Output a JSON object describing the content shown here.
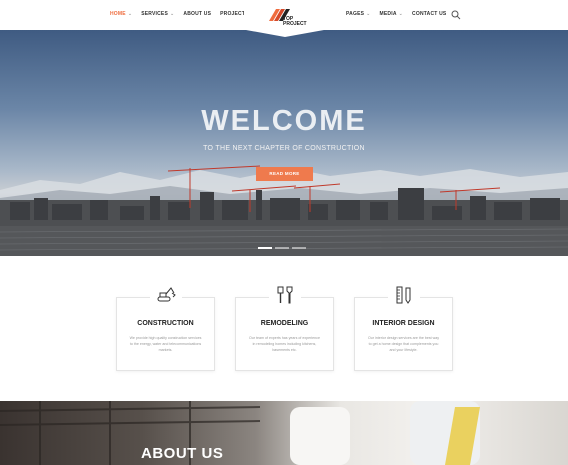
{
  "header": {
    "nav_left": [
      {
        "label": "HOME",
        "has_dropdown": true,
        "active": true
      },
      {
        "label": "SERVICES",
        "has_dropdown": true,
        "active": false
      },
      {
        "label": "ABOUT US",
        "has_dropdown": false,
        "active": false
      },
      {
        "label": "PROJECTS",
        "has_dropdown": true,
        "active": false
      }
    ],
    "nav_right": [
      {
        "label": "PAGES",
        "has_dropdown": true
      },
      {
        "label": "MEDIA",
        "has_dropdown": true
      },
      {
        "label": "CONTACT US",
        "has_dropdown": false
      }
    ],
    "logo_line1": "TOP",
    "logo_line2": "PROJECT",
    "search_icon": "search-icon",
    "chevron": "⌄"
  },
  "hero": {
    "title": "WELCOME",
    "subtitle": "TO THE NEXT CHAPTER OF CONSTRUCTION",
    "button_label": "READ MORE",
    "slides": 3,
    "active_slide": 1
  },
  "services": [
    {
      "title": "CONSTRUCTION",
      "text": "We provide high quality construction services to the energy, water and telecommunications markets.",
      "icon": "excavator-icon"
    },
    {
      "title": "REMODELING",
      "text": "Our team of experts has years of experience in remodeling homes including kitchens, basements etc.",
      "icon": "paint-tools-icon"
    },
    {
      "title": "INTERIOR DESIGN",
      "text": "Our interior design services are the best way to get a home design that complements you and your lifestyle.",
      "icon": "ruler-pencil-icon"
    }
  ],
  "about": {
    "title": "ABOUT US"
  },
  "colors": {
    "accent": "#ef7a4d",
    "nav_active": "#ef6c3e",
    "text_dark": "#222222"
  }
}
